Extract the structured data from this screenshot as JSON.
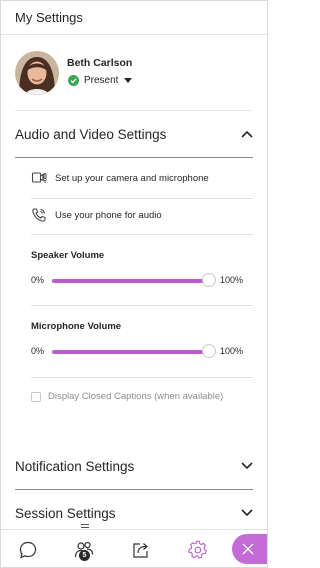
{
  "header": {
    "title": "My Settings"
  },
  "profile": {
    "name": "Beth Carlson",
    "status": "Present"
  },
  "audio_video": {
    "title": "Audio and Video Settings",
    "camera_mic_label": "Set up your camera and microphone",
    "phone_label": "Use your phone for audio",
    "speaker": {
      "label": "Speaker Volume",
      "min_label": "0%",
      "max_label": "100%",
      "level_percent": 100
    },
    "microphone": {
      "label": "Microphone Volume",
      "min_label": "0%",
      "max_label": "100%",
      "level_percent": 100
    },
    "captions_label": "Display Closed Captions (when available)"
  },
  "notifications": {
    "title": "Notification Settings"
  },
  "session": {
    "title": "Session Settings"
  },
  "tabbar": {
    "attendees_count": "5"
  },
  "colors": {
    "accent": "#bc5bd0",
    "close_button": "#c36bd6",
    "present": "#3aa652"
  }
}
